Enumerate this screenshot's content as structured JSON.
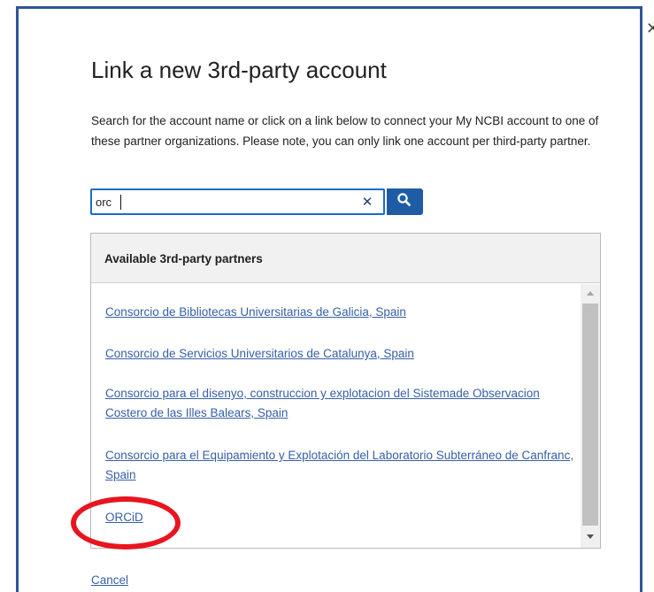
{
  "dialog": {
    "title": "Link a new 3rd-party account",
    "description": "Search for the account name or click on a link below to connect your My NCBI account to one of these partner organizations. Please note, you can only link one account per third-party partner.",
    "close_icon": "close-icon"
  },
  "search": {
    "value": "orc",
    "clear_icon": "clear-x-icon",
    "button_icon": "search-icon"
  },
  "partners": {
    "header": "Available 3rd-party partners",
    "items": [
      {
        "label": "Consorcio de Bibliotecas Universitarias de Galicia, Spain"
      },
      {
        "label": "Consorcio de Servicios Universitarios de Catalunya, Spain"
      },
      {
        "label": "Consorcio para el disenyo, construccion y explotacion del Sistemade Observacion Costero de las Illes Balears, Spain"
      },
      {
        "label": "Consorcio para el Equipamiento y Explotación del Laboratorio Subterráneo de Canfranc, Spain"
      },
      {
        "label": "ORCiD"
      }
    ]
  },
  "footer": {
    "cancel_label": "Cancel"
  },
  "colors": {
    "dialog_border": "#2f5596",
    "link": "#3760a8",
    "search_button": "#1e5da6",
    "highlight_ring": "#e8151f"
  }
}
